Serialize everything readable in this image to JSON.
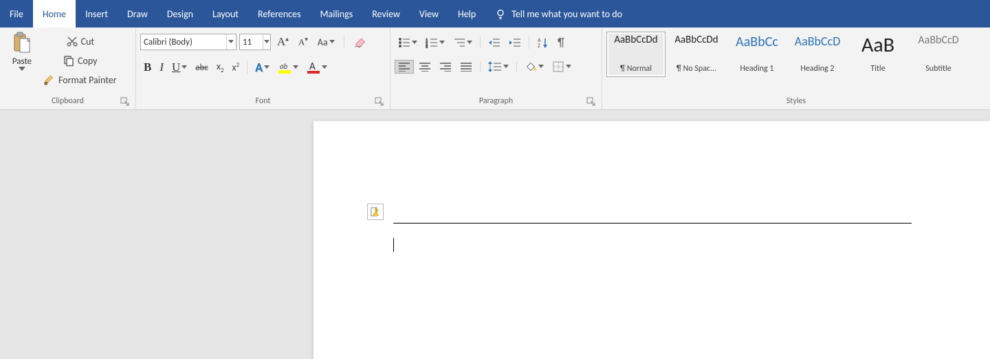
{
  "menu": {
    "items": [
      "File",
      "Home",
      "Insert",
      "Draw",
      "Design",
      "Layout",
      "References",
      "Mailings",
      "Review",
      "View",
      "Help"
    ],
    "active": "Home",
    "tellme": "Tell me what you want to do"
  },
  "clipboard": {
    "paste": "Paste",
    "cut": "Cut",
    "copy": "Copy",
    "formatpainter": "Format Painter",
    "group_label": "Clipboard"
  },
  "font": {
    "name": "Calibri (Body)",
    "size": "11",
    "group_label": "Font"
  },
  "paragraph": {
    "group_label": "Paragraph"
  },
  "styles": {
    "group_label": "Styles",
    "items": [
      {
        "sample": "AaBbCcDd",
        "label": "¶ Normal",
        "color": "#222222",
        "size": "15px",
        "selected": true
      },
      {
        "sample": "AaBbCcDd",
        "label": "¶ No Spac...",
        "color": "#222222",
        "size": "15px",
        "selected": false
      },
      {
        "sample": "AaBbCc",
        "label": "Heading 1",
        "color": "#2e74b5",
        "size": "20px",
        "selected": false
      },
      {
        "sample": "AaBbCcD",
        "label": "Heading 2",
        "color": "#2e74b5",
        "size": "18px",
        "selected": false
      },
      {
        "sample": "AaB",
        "label": "Title",
        "color": "#222222",
        "size": "30px",
        "selected": false
      },
      {
        "sample": "AaBbCcD",
        "label": "Subtitle",
        "color": "#777777",
        "size": "16px",
        "selected": false
      }
    ]
  }
}
